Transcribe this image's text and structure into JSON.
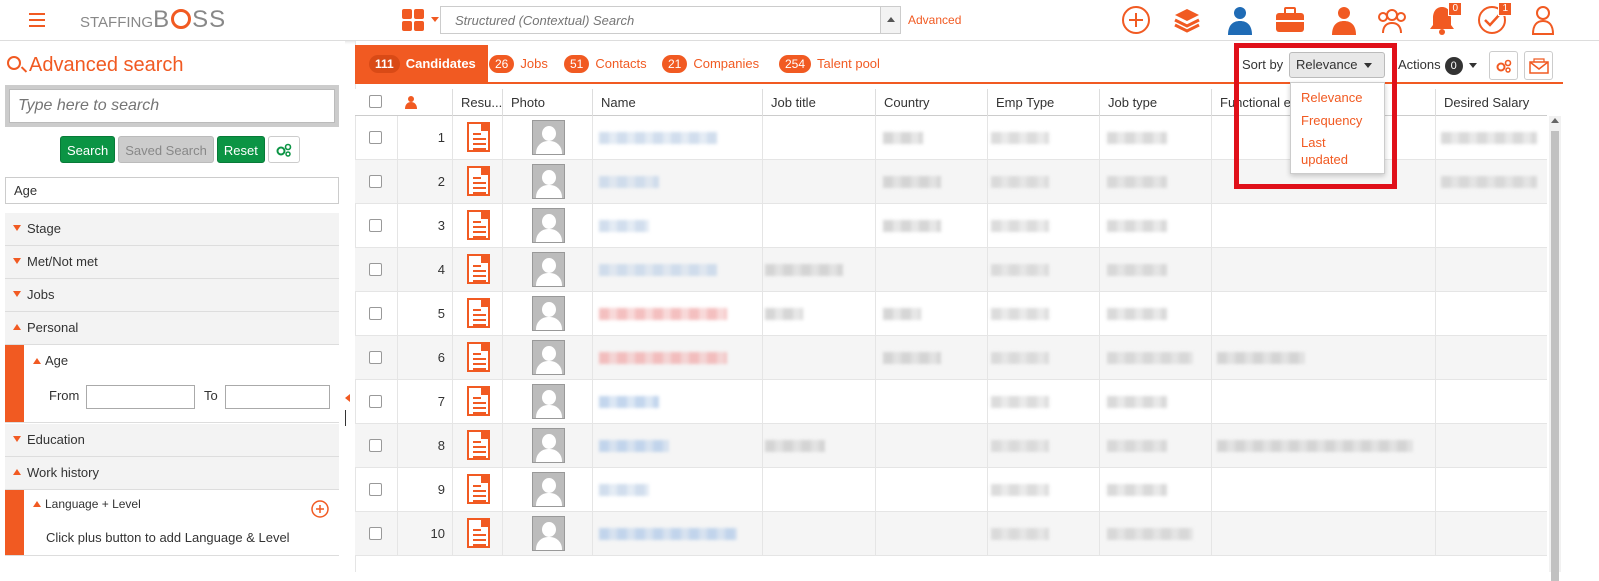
{
  "header": {
    "logo_prefix": "STAFFING",
    "logo_b": "B",
    "logo_ss": "SS",
    "search_placeholder": "Structured (Contextual) Search",
    "advanced_label": "Advanced",
    "notifications_count": "0",
    "tasks_count": "1",
    "accent_color": "#f15a22",
    "icons": [
      "menu-icon",
      "apps-grid-icon",
      "add-icon",
      "layers-icon",
      "candidate-icon",
      "briefcase-icon",
      "contact-icon",
      "team-icon",
      "bell-icon",
      "tasks-check-icon",
      "profile-icon"
    ]
  },
  "left": {
    "title": "Advanced search",
    "search_placeholder": "Type here to search",
    "buttons": {
      "search": "Search",
      "saved_search": "Saved Search",
      "reset": "Reset"
    },
    "filter_value": "Age",
    "facets": {
      "stage": "Stage",
      "met": "Met/Not met",
      "jobs": "Jobs",
      "personal": "Personal",
      "age": "Age",
      "from": "From",
      "to": "To",
      "education": "Education",
      "work_history": "Work history",
      "language_level": "Language + Level",
      "language_hint": "Click plus button to add Language & Level"
    }
  },
  "tabs": [
    {
      "count": "111",
      "label": "Candidates"
    },
    {
      "count": "26",
      "label": "Jobs"
    },
    {
      "count": "51",
      "label": "Contacts"
    },
    {
      "count": "21",
      "label": "Companies"
    },
    {
      "count": "254",
      "label": "Talent pool"
    }
  ],
  "toolbar": {
    "sort_label": "Sort by",
    "sort_value": "Relevance",
    "sort_options": [
      "Relevance",
      "Frequency",
      "Last",
      "updated"
    ],
    "actions_label": "Actions",
    "actions_count": "0"
  },
  "table": {
    "columns": [
      "Resu...",
      "Photo",
      "Name",
      "Job title",
      "Country",
      "Emp Type",
      "Job type",
      "Functional ex",
      "Desired Salary"
    ],
    "row_numbers": [
      "1",
      "2",
      "3",
      "4",
      "5",
      "6",
      "7",
      "8",
      "9",
      "10"
    ]
  }
}
